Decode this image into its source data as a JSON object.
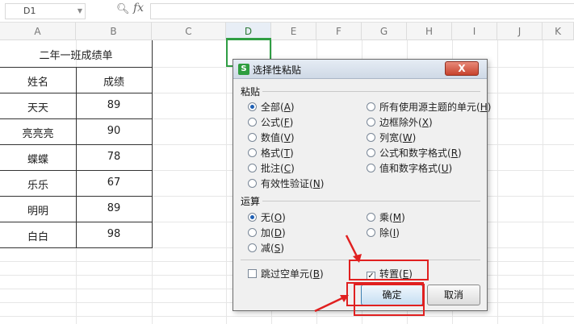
{
  "formula_bar": {
    "cell_ref": "D1",
    "fx": "fx"
  },
  "columns": [
    "A",
    "B",
    "C",
    "D",
    "E",
    "F",
    "G",
    "H",
    "I",
    "J",
    "K"
  ],
  "table": {
    "title": "二年一班成绩单",
    "headers": [
      "姓名",
      "成绩"
    ],
    "rows": [
      [
        "天天",
        "89"
      ],
      [
        "亮亮亮",
        "90"
      ],
      [
        "蝶蝶",
        "78"
      ],
      [
        "乐乐",
        "67"
      ],
      [
        "明明",
        "89"
      ],
      [
        "白白",
        "98"
      ]
    ]
  },
  "dialog": {
    "title": "选择性粘贴",
    "close_label": "X",
    "paste_section": "粘贴",
    "paste_left": [
      {
        "label": "全部",
        "key": "A",
        "checked": true
      },
      {
        "label": "公式",
        "key": "F",
        "checked": false
      },
      {
        "label": "数值",
        "key": "V",
        "checked": false
      },
      {
        "label": "格式",
        "key": "T",
        "checked": false
      },
      {
        "label": "批注",
        "key": "C",
        "checked": false
      },
      {
        "label": "有效性验证",
        "key": "N",
        "checked": false
      }
    ],
    "paste_right": [
      {
        "label": "所有使用源主题的单元",
        "key": "H",
        "checked": false
      },
      {
        "label": "边框除外",
        "key": "X",
        "checked": false
      },
      {
        "label": "列宽",
        "key": "W",
        "checked": false
      },
      {
        "label": "公式和数字格式",
        "key": "R",
        "checked": false
      },
      {
        "label": "值和数字格式",
        "key": "U",
        "checked": false
      }
    ],
    "op_section": "运算",
    "op_left": [
      {
        "label": "无",
        "key": "O",
        "checked": true
      },
      {
        "label": "加",
        "key": "D",
        "checked": false
      },
      {
        "label": "减",
        "key": "S",
        "checked": false
      }
    ],
    "op_right": [
      {
        "label": "乘",
        "key": "M",
        "checked": false
      },
      {
        "label": "除",
        "key": "I",
        "checked": false
      }
    ],
    "skip_blanks": {
      "label": "跳过空单元",
      "key": "B",
      "checked": false
    },
    "transpose": {
      "label": "转置",
      "key": "E",
      "checked": true
    },
    "ok_label": "确定",
    "cancel_label": "取消"
  },
  "colors": {
    "accent_green": "#2f9e44",
    "annotation_red": "#e02020"
  }
}
